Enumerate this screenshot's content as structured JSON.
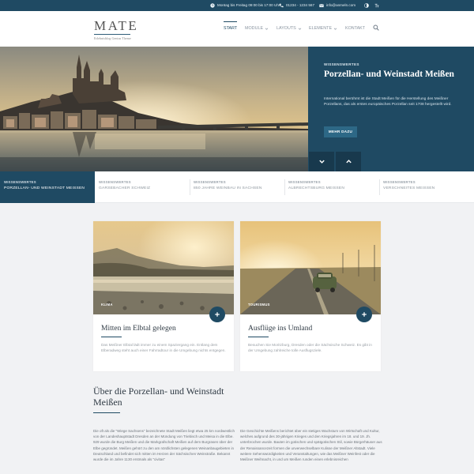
{
  "topbar": {
    "hours": "Montag bis Freitag 09:00 bis 17:00 Uhr",
    "phone": "01234 - 1234 567",
    "email": "info@anmeln.com",
    "icons": [
      "clock-icon",
      "phone-icon",
      "mail-icon",
      "contrast-icon",
      "text-size-icon"
    ]
  },
  "logo": {
    "name": "MATE",
    "tagline": "Erlebnisblog Genius Theme"
  },
  "nav": {
    "items": [
      {
        "label": "START",
        "active": true,
        "dropdown": false
      },
      {
        "label": "MODULE",
        "active": false,
        "dropdown": true
      },
      {
        "label": "LAYOUTS",
        "active": false,
        "dropdown": true
      },
      {
        "label": "ELEMENTE",
        "active": false,
        "dropdown": true
      },
      {
        "label": "KONTAKT",
        "active": false,
        "dropdown": false
      }
    ],
    "search_icon": "search-icon"
  },
  "hero": {
    "kicker": "WISSENSWERTES",
    "title": "Porzellan- und Weinstadt Meißen",
    "text": "International berühmt ist die Stadt Meißen für die Herstellung des Meißner Porzellans, das als erstes europäisches Porzellan seit 1708 hergestellt wird.",
    "button": "MEHR DAZU"
  },
  "tabs": [
    {
      "kicker": "WISSENSWERTES",
      "label": "PORZELLAN- UND WEINSTADT MEISSEN",
      "active": true
    },
    {
      "kicker": "WISSENSWERTES",
      "label": "GARSEBACHER SCHWEIZ",
      "active": false
    },
    {
      "kicker": "WISSENSWERTES",
      "label": "850 JAHRE WEINBAU IN SACHSEN",
      "active": false
    },
    {
      "kicker": "WISSENSWERTES",
      "label": "ALBRECHTSBURG MEISSEN",
      "active": false
    },
    {
      "kicker": "WISSENSWERTES",
      "label": "VERSCHNEITES MEISSEN",
      "active": false
    }
  ],
  "cards": [
    {
      "tag": "KLIMA",
      "title": "Mitten im Elbtal gelegen",
      "text": "Das Meißner Elbtal lädt immer zu einem Spaziergang ein. Entlang dem Elberadweg steht auch einer Fahrradtour in die Umgebung nichts entgegen."
    },
    {
      "tag": "TOURISMUS",
      "title": "Ausflüge ins Umland",
      "text": "Besuchen Sie Moritzburg, Dresden oder die Sächsische Schweiz. Es gibt in der Umgebung zahlreiche tolle Ausflugsziele."
    }
  ],
  "about": {
    "title": "Über die Porzellan- und Weinstadt Meißen",
    "col1": "Die oft als die \"Wiege Sachsens\" bezeichnete Stadt Meißen liegt etwa 25 km nordwestlich von der Landeshauptstadt Dresden an der Mündung von Triebisch und Meisa in die Elbe. 929 wurde die Burg Meißen und die Markgrafschaft Meißen auf dem Burgrasen über der Elbe gegründet. Meißen gehört zu den am nördlichsten gelegenen Weinanbaugebieten in Deutschland und befindet sich mitten im Herzen der Sächsischen Weinstraße. Bekannt wurde die im Jahre 1130 erstmals als \"civitas\"",
    "col2": "Die Geschichte Meißens berichtet über ein stetiges Wachstum von Wirtschaft und Kultur, welches aufgrund des 30-jährigen Krieges und den Kriegsjahren im 18. und 19. Jh. unterbrochen wurde. Bauten im gotischen und spätgotischen Stil, sowie Bürgerhäuser aus der Renaissancezeit formen die unverwechselbare Kulisse der Meißner Altstadt. Viele weitere Sehenswürdigkeiten und Veranstaltungen, wie das Meißner Weinfest oder die Meißner Weihnacht, in und um Meißen runden einen erlebnisreichen"
  },
  "colors": {
    "primary": "#1f4a63",
    "primary_dark": "#18394d",
    "button": "#2d6886",
    "background": "#f1f2f4"
  }
}
